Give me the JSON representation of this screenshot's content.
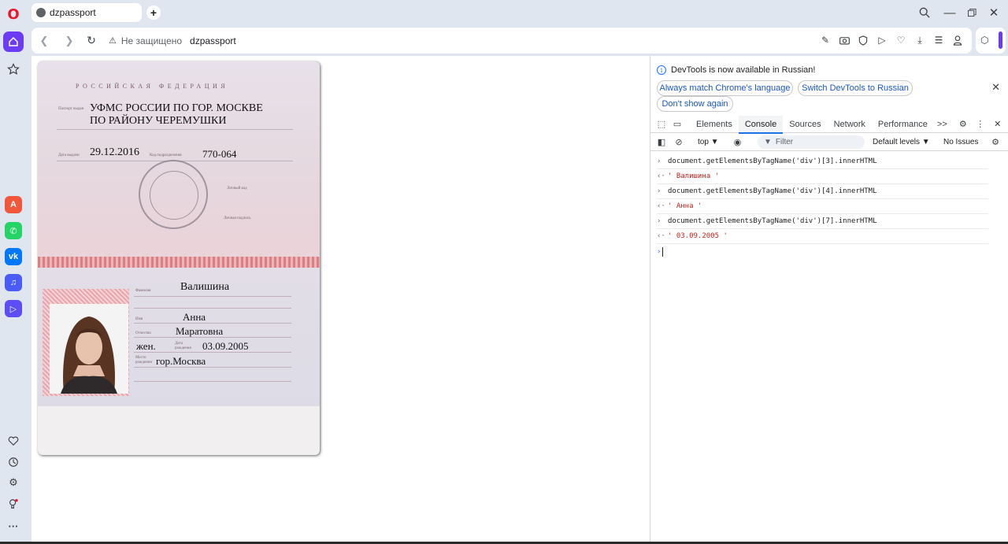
{
  "browser": {
    "tab_title": "dzpassport",
    "new_tab": "+",
    "security_label": "Не защищено",
    "url_host": "dzpassport"
  },
  "page": {
    "passport": {
      "country": "РОССИЙСКАЯ ФЕДЕРАЦИЯ",
      "issued_by_label": "Паспорт выдан",
      "issued_by_line1": "УФМС РОССИИ ПО ГОР. МОСКВЕ",
      "issued_by_line2": "ПО РАЙОНУ ЧЕРЕМУШКИ",
      "issue_date_label": "Дата выдачи",
      "issue_date": "29.12.2016",
      "dept_code_label": "Код подразделения",
      "dept_code": "770-064",
      "personal_code_label": "Личный код",
      "signature_label": "Личная подпись",
      "surname_label": "Фамилия",
      "surname": "Валишина",
      "name_label": "Имя",
      "name": "Анна",
      "patronymic_label": "Отчество",
      "patronymic": "Маратовна",
      "sex": "жен.",
      "birth_date_label": "Дата рождения",
      "birth_date": "03.09.2005",
      "birth_place_label": "Место рождения",
      "birth_place": "гор.Москва"
    }
  },
  "devtools": {
    "info_message": "DevTools is now available in Russian!",
    "btn_match_language": "Always match Chrome's language",
    "btn_switch_russian": "Switch DevTools to Russian",
    "btn_dont_show": "Don't show again",
    "tabs": [
      "Elements",
      "Console",
      "Sources",
      "Network",
      "Performance"
    ],
    "more_tabs": ">>",
    "context": "top ▼",
    "filter_placeholder": "Filter",
    "levels": "Default levels ▼",
    "issues": "No Issues",
    "console": [
      {
        "type": "input",
        "text": "document.getElementsByTagName('div')[3].innerHTML"
      },
      {
        "type": "output",
        "text": "' Валишина '"
      },
      {
        "type": "input",
        "text": "document.getElementsByTagName('div')[4].innerHTML"
      },
      {
        "type": "output",
        "text": "' Анна '"
      },
      {
        "type": "input",
        "text": "document.getElementsByTagName('div')[7].innerHTML"
      },
      {
        "type": "output",
        "text": "' 03.09.2005  '"
      }
    ]
  },
  "colors": {
    "opera_accent": "#6c3cf5",
    "opera_red": "#e8182c",
    "devtools_blue": "#1a73e8",
    "console_string": "#c5221f"
  }
}
